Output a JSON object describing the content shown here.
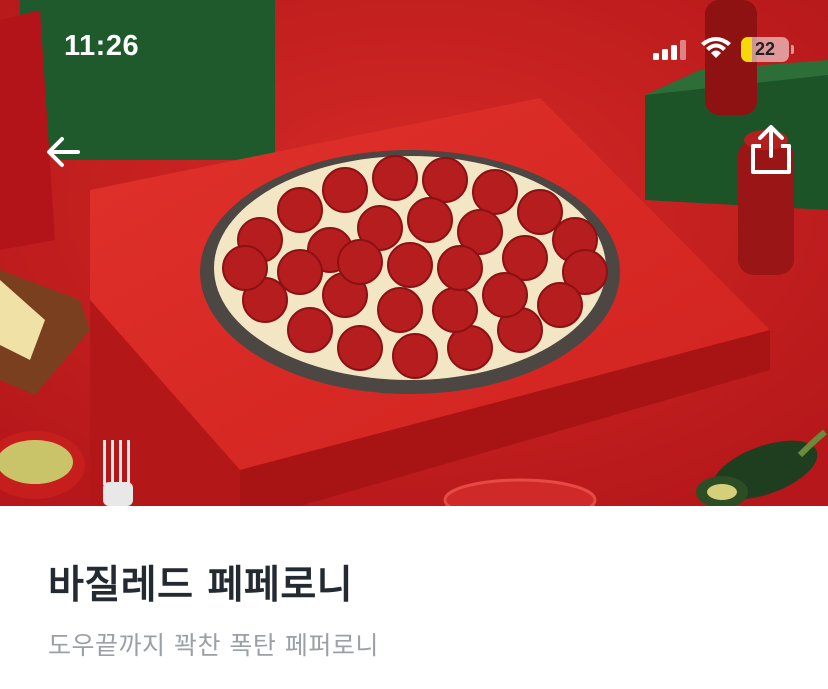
{
  "status_bar": {
    "time": "11:26",
    "battery_level": "22",
    "battery_fraction": 0.22
  },
  "header": {
    "back_icon": "arrow-left-icon",
    "share_icon": "share-icon"
  },
  "product": {
    "name": "바질레드 페페로니",
    "description": "도우끝까지 꽉찬 폭탄 페퍼로니"
  },
  "colors": {
    "hero_background": "#c8201f",
    "title_text": "#242a31",
    "subtitle_text": "#9aa0a6",
    "battery_fill": "#f5d90a"
  }
}
